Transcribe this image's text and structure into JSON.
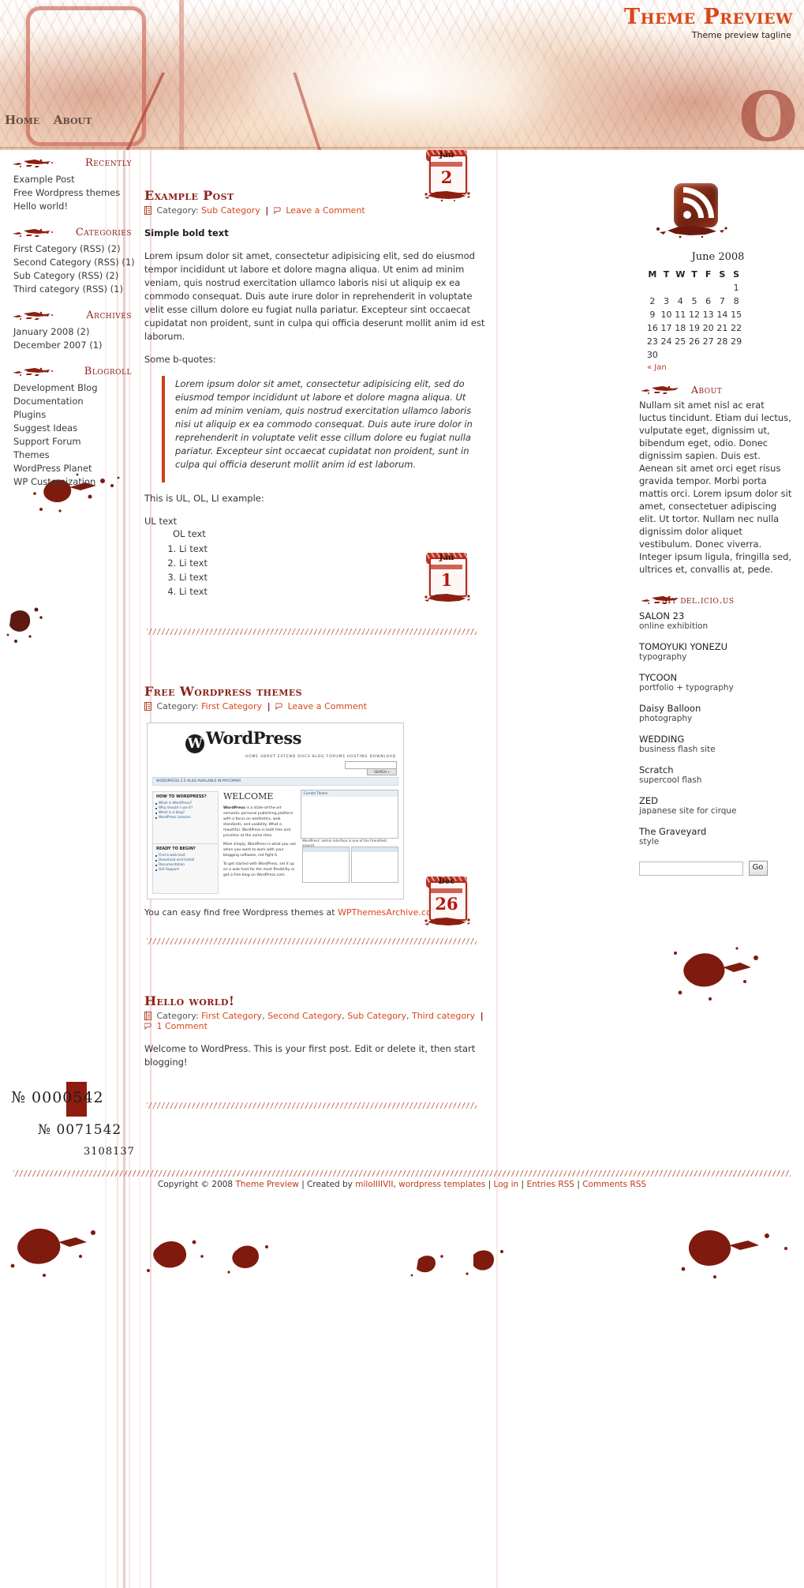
{
  "header": {
    "title": "Theme Preview",
    "tagline": "Theme preview tagline",
    "nav": [
      {
        "label": "Home",
        "name": "nav-home"
      },
      {
        "label": "About",
        "name": "nav-about"
      }
    ]
  },
  "sidebar_left": {
    "widgets": [
      {
        "title": "Recently",
        "items": [
          "Example Post",
          "Free Wordpress themes",
          "Hello world!"
        ]
      },
      {
        "title": "Categories",
        "items": [
          "First Category (RSS) (2)",
          "Second Category (RSS) (1)",
          "Sub Category (RSS) (2)",
          "Third category (RSS) (1)"
        ]
      },
      {
        "title": "Archives",
        "items": [
          "January 2008 (2)",
          "December 2007 (1)"
        ]
      },
      {
        "title": "Blogroll",
        "items": [
          "Development Blog",
          "Documentation",
          "Plugins",
          "Suggest Ideas",
          "Support Forum",
          "Themes",
          "WordPress Planet",
          "WP Customization"
        ]
      }
    ]
  },
  "posts": [
    {
      "title": "Example Post",
      "date_badge": {
        "month": "Jan",
        "day": "2"
      },
      "category_label": "Category:",
      "categories": [
        "Sub Category"
      ],
      "comment_link": "Leave a Comment",
      "bold_text": "Simple bold text",
      "paragraph1": "Lorem ipsum dolor sit amet, consectetur adipisicing elit, sed do eiusmod tempor incididunt ut labore et dolore magna aliqua. Ut enim ad minim veniam, quis nostrud exercitation ullamco laboris nisi ut aliquip ex ea commodo consequat. Duis aute irure dolor in reprehenderit in voluptate velit esse cillum dolore eu fugiat nulla pariatur. Excepteur sint occaecat cupidatat non proident, sunt in culpa qui officia deserunt mollit anim id est laborum.",
      "quotes_intro": "Some b-quotes:",
      "blockquote": "Lorem ipsum dolor sit amet, consectetur adipisicing elit, sed do eiusmod tempor incididunt ut labore et dolore magna aliqua. Ut enim ad minim veniam, quis nostrud exercitation ullamco laboris nisi ut aliquip ex ea commodo consequat. Duis aute irure dolor in reprehenderit in voluptate velit esse cillum dolore eu fugiat nulla pariatur. Excepteur sint occaecat cupidatat non proident, sunt in culpa qui officia deserunt mollit anim id est laborum.",
      "list_intro": "This is UL, OL, LI example:",
      "ul_text": "UL text",
      "ol_text": "OL text",
      "li_items": [
        "Li text",
        "Li text",
        "Li text",
        "Li text"
      ]
    },
    {
      "title": "Free Wordpress themes",
      "date_badge": {
        "month": "Jan",
        "day": "1"
      },
      "category_label": "Category:",
      "categories": [
        "First Category"
      ],
      "comment_link": "Leave a Comment",
      "closing_prefix": "You can easy find free Wordpress themes at ",
      "closing_link": "WPThemesArchive.com",
      "screenshot": {
        "logo": "WordPress",
        "nav": "HOME   ABOUT   EXTEND   DOCS   BLOG   FORUMS   HOSTING   DOWNLOAD",
        "search_button": "SEARCH »",
        "announce": "WORDPRESS 2.5 ALSO AVAILABLE IN MYCOMAR",
        "welcome": "WELCOME",
        "left_col_heading": "HOW TO WORDPRESS?",
        "left_col_items": [
          "What is WordPress?",
          "Why should I use it?",
          "What is a blog?",
          "WordPress Lessons"
        ],
        "left_col2_heading": "READY TO BEGIN?",
        "left_col2_items": [
          "Find a web host",
          "Download and Install",
          "Documentation",
          "Get Support"
        ],
        "body_lead": "WordPress",
        "body_text": "is a state-of-the-art semantic personal publishing platform with a focus on aesthetics, web standards, and usability. What a mouthful. WordPress is both free and priceless at the same time.",
        "body_text2": "More simply, WordPress is what you use when you want to work with your blogging software, not fight it.",
        "body_text3": "To get started with WordPress, set it up on a web host for the most flexibility or get a free blog on WordPress.com.",
        "caption": "WordPress' admin interface is one of the friendliest around.",
        "panel_title": "Current Theme"
      }
    },
    {
      "title": "Hello world!",
      "date_badge": {
        "month": "Dec",
        "day": "26"
      },
      "category_label": "Category:",
      "categories": [
        "First Category",
        "Second Category",
        "Sub Category",
        "Third category"
      ],
      "comment_link": "1 Comment",
      "paragraph1": "Welcome to WordPress. This is your first post. Edit or delete it, then start blogging!"
    }
  ],
  "sidebar_right": {
    "rss_icon": "rss-icon",
    "calendar": {
      "title": "June 2008",
      "weekdays": [
        "M",
        "T",
        "W",
        "T",
        "F",
        "S",
        "S"
      ],
      "weeks": [
        [
          "",
          "",
          "",
          "",
          "",
          "",
          "1"
        ],
        [
          "2",
          "3",
          "4",
          "5",
          "6",
          "7",
          "8"
        ],
        [
          "9",
          "10",
          "11",
          "12",
          "13",
          "14",
          "15"
        ],
        [
          "16",
          "17",
          "18",
          "19",
          "20",
          "21",
          "22"
        ],
        [
          "23",
          "24",
          "25",
          "26",
          "27",
          "28",
          "29"
        ],
        [
          "30",
          "",
          "",
          "",
          "",
          "",
          ""
        ]
      ],
      "prev_link": "« Jan"
    },
    "about": {
      "title": "About",
      "text": "Nullam sit amet nisl ac erat luctus tincidunt. Etiam dui lectus, vulputate eget, dignissim ut, bibendum eget, odio. Donec dignissim sapien. Duis est. Aenean sit amet orci eget risus gravida tempor. Morbi porta mattis orci. Lorem ipsum dolor sit amet, consectetuer adipiscing elit. Ut tortor. Nullam nec nulla dignissim dolor aliquet vestibulum. Donec viverra. Integer ipsum ligula, fringilla sed, ultrices et, convallis at, pede."
    },
    "delicious": {
      "title": "My del.icio.us",
      "items": [
        {
          "name": "SALON 23",
          "desc": "online exhibition"
        },
        {
          "name": "TOMOYUKI YONEZU",
          "desc": "typography"
        },
        {
          "name": "TYCOON",
          "desc": "portfolio + typography"
        },
        {
          "name": "Daisy Balloon",
          "desc": "photography"
        },
        {
          "name": "WEDDING",
          "desc": "business flash site"
        },
        {
          "name": "Scratch",
          "desc": "supercool flash"
        },
        {
          "name": "ZED",
          "desc": "japanese site for cirque"
        },
        {
          "name": "The Graveyard",
          "desc": "style"
        }
      ]
    },
    "search": {
      "value": "",
      "placeholder": "",
      "button": "Go"
    }
  },
  "counters": {
    "line1": "№ 0000542",
    "line2": "№ 0071542",
    "line3": "3108137"
  },
  "footer": {
    "copyright": "Copyright © 2008 ",
    "theme_link": "Theme Preview",
    "created_by": " | Created by ",
    "author_link": "miloIIIIVII",
    "sep1": ", ",
    "templates_link": "wordpress templates",
    "sep2": " | ",
    "login_link": "Log in",
    "sep3": " | ",
    "entries_link": "Entries RSS",
    "sep4": " | ",
    "comments_link": "Comments RSS"
  },
  "colors": {
    "accent_red": "#8c2219",
    "link_orange": "#d8481b",
    "title_red": "#d8481b",
    "quote_bar": "#cf4014"
  }
}
